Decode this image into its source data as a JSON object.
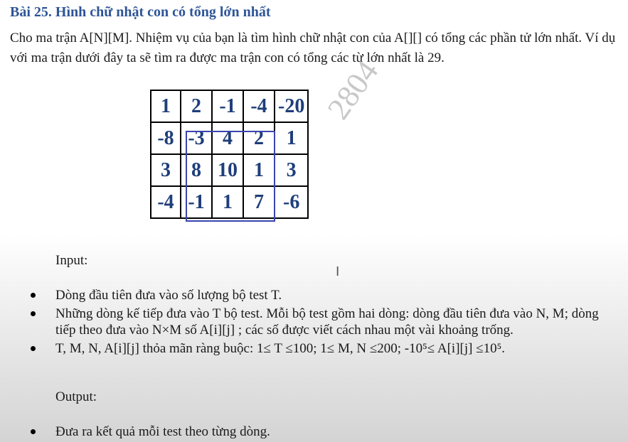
{
  "title": "Bài 25. Hình chữ nhật con có tổng lớn nhất",
  "intro": "Cho ma trận A[N][M]. Nhiệm vụ của bạn là tìm hình chữ nhật con của A[][] có tổng các phần tử lớn nhất. Ví dụ với ma trận dưới đây ta sẽ tìm ra được ma trận con có tổng các từ lớn nhất là 29.",
  "matrix": {
    "rows": [
      [
        "1",
        "2",
        "-1",
        "-4",
        "-20"
      ],
      [
        "-8",
        "-3",
        "4",
        "2",
        "1"
      ],
      [
        "3",
        "8",
        "10",
        "1",
        "3"
      ],
      [
        "-4",
        "-1",
        "1",
        "7",
        "-6"
      ]
    ]
  },
  "watermark": "2804",
  "input_label": "Input:",
  "input_items": [
    "Dòng đầu tiên đưa vào số lượng bộ test T.",
    "Những dòng kế tiếp đưa vào T bộ test. Mỗi bộ test gồm hai dòng: dòng đầu tiên đưa vào N, M; dòng tiếp theo đưa vào N×M số A[i][j] ; các số được viết cách nhau một vài khoảng trống.",
    "T, M, N, A[i][j] thỏa mãn ràng buộc: 1≤ T ≤100; 1≤ M, N ≤200; -10⁵≤ A[i][j] ≤10⁵."
  ],
  "output_label": "Output:",
  "output_items": [
    "Đưa ra kết quả mỗi test theo từng dòng."
  ],
  "cursor_icon": "I"
}
